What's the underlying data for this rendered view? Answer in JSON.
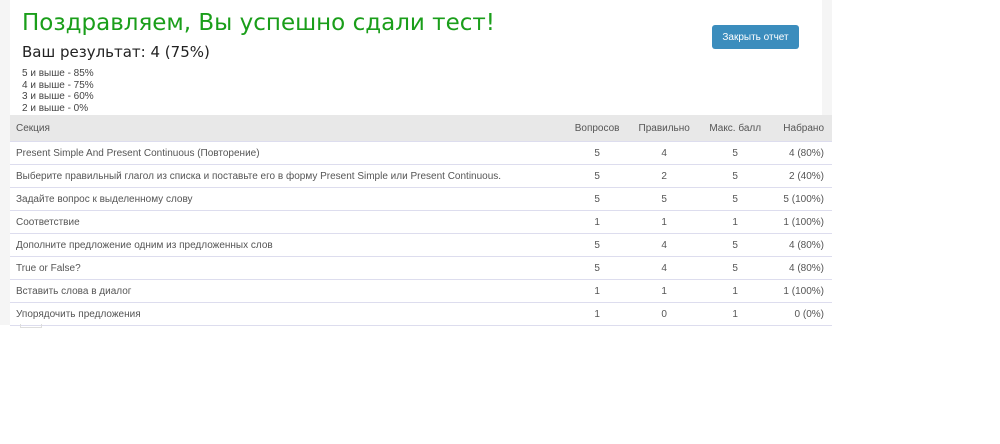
{
  "title": "Поздравляем, Вы успешно сдали тест!",
  "result": "Ваш результат: 4 (75%)",
  "grades": [
    "5 и выше - 85%",
    "4 и выше - 75%",
    "3 и выше - 60%",
    "2 и выше - 0%"
  ],
  "close_button": "Закрыть отчет",
  "columns": [
    "Секция",
    "Вопросов",
    "Правильно",
    "Макс. балл",
    "Набрано"
  ],
  "rows": [
    [
      "Present Simple And Present Continuous (Повторение)",
      "5",
      "4",
      "5",
      "4 (80%)"
    ],
    [
      "Выберите правильный глагол из списка и поставьте его в форму Present Simple или Present Continuous.",
      "5",
      "2",
      "5",
      "2 (40%)"
    ],
    [
      "Задайте вопрос к выделенному слову",
      "5",
      "5",
      "5",
      "5 (100%)"
    ],
    [
      "Соответствие",
      "1",
      "1",
      "1",
      "1 (100%)"
    ],
    [
      "Дополните предложение одним из предложенных слов",
      "5",
      "4",
      "5",
      "4 (80%)"
    ],
    [
      "True or False?",
      "5",
      "4",
      "5",
      "4 (80%)"
    ],
    [
      "Вставить слова в диалог",
      "1",
      "1",
      "1",
      "1 (100%)"
    ],
    [
      "Упорядочить предложения",
      "1",
      "0",
      "1",
      "0 (0%)"
    ]
  ]
}
